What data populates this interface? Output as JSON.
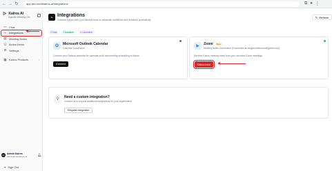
{
  "browser": {
    "url": "app.dev.meetkairos.ai/integrations"
  },
  "brand": {
    "name": "Kairos AI",
    "tagline": "Agentic Meeting OS"
  },
  "sidebar": {
    "items": [
      {
        "label": "Chat",
        "icon": "chat-icon"
      },
      {
        "label": "Integrations",
        "icon": "plug-icon",
        "active": true
      },
      {
        "label": "Meeting Notes",
        "icon": "notes-icon"
      },
      {
        "label": "Action Items",
        "icon": "checklist-icon"
      },
      {
        "label": "Settings",
        "icon": "gear-icon"
      }
    ],
    "products_label": "Kairos Products"
  },
  "user": {
    "initials": "AK",
    "name": "Admin Kairos",
    "email": "admin@meetkairos.ai"
  },
  "signout_label": "Sign Out",
  "header": {
    "title": "Integrations",
    "subtitle": "Connect Kairos with your favorite tools to automate workflows and enhance productivity",
    "refresh_label": "Refresh"
  },
  "stats": {
    "total": "2 Total",
    "available": "2 Available",
    "connected": "1 Connected"
  },
  "integrations": [
    {
      "name": "Microsoft Outlook Calendar",
      "type": "Calendar Connection",
      "description": "Connect your Outlook calendar for calendar audit and meeting scheduling in Kairos.",
      "action": "Connect",
      "status_color": "#6b7280"
    },
    {
      "name": "Zoom",
      "badge": "Beta",
      "type": "Meeting Notes Connection (Connected as singhrohitsharma@gmail.com)",
      "description": "Receive Kairos meeting notes from your recorded Zoom meetings.",
      "action": "Disconnect",
      "status_color": "#22c55e"
    }
  ],
  "custom": {
    "title": "Need a custom integration?",
    "subtitle": "Contact us to request additional integrations for your organization.",
    "button": "Request Integration"
  },
  "colors": {
    "accent_dark": "#111111",
    "danger": "#dc2626",
    "annotation": "#d32f2f"
  }
}
